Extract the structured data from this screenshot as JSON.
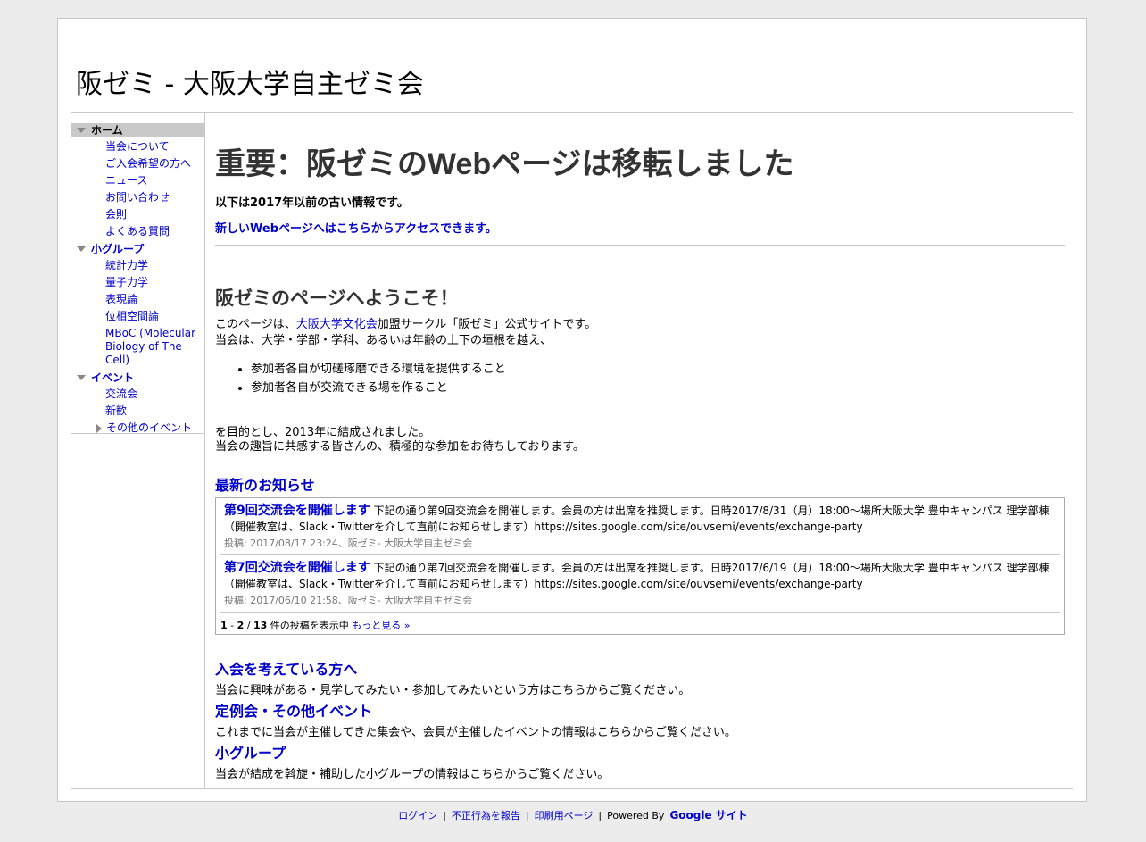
{
  "site": {
    "title": "阪ゼミ - 大阪大学自主ゼミ会"
  },
  "sidebar": {
    "groups": [
      {
        "label": "ホーム",
        "selected": true,
        "items": [
          "当会について",
          "ご入会希望の方へ",
          "ニュース",
          "お問い合わせ",
          "会則",
          "よくある質問"
        ]
      },
      {
        "label": "小グループ",
        "selected": false,
        "items": [
          "統計力学",
          "量子力学",
          "表現論",
          "位相空間論",
          "MBoC (Molecular Biology of The Cell)"
        ]
      },
      {
        "label": "イベント",
        "selected": false,
        "items": [
          "交流会",
          "新歓",
          "その他のイベント"
        ]
      }
    ]
  },
  "main": {
    "title": "重要：阪ゼミのWebページは移転しました",
    "notice_old": "以下は2017年以前の古い情報です。",
    "notice_link": "新しいWebページへはこちらからアクセスできます。",
    "welcome_title": "阪ゼミのページへようこそ！",
    "intro_prefix": "このページは、",
    "intro_link": "大阪大学文化会",
    "intro_suffix": "加盟サークル「阪ゼミ」公式サイトです。",
    "intro_line2": "当会は、大学・学部・学科、あるいは年齢の上下の垣根を越え、",
    "goals": [
      "参加者各自が切磋琢磨できる環境を提供すること",
      "参加者各自が交流できる場を作ること"
    ],
    "outro_line1": "を目的とし、2013年に結成されました。",
    "outro_line2": "当会の趣旨に共感する皆さんの、積極的な参加をお待ちしております。",
    "news": {
      "title": "最新のお知らせ",
      "entries": [
        {
          "headline": "第9回交流会を開催します",
          "body": " 下記の通り第9回交流会を開催します。会員の方は出席を推奨します。日時2017/8/31（月）18:00〜場所大阪大学 豊中キャンパス 理学部棟（開催教室は、Slack・Twitterを介して直前にお知らせします）https://sites.google.com/site/ouvsemi/events/exchange-party",
          "meta": "投稿: 2017/08/17 23:24、阪ゼミ- 大阪大学自主ゼミ会"
        },
        {
          "headline": "第7回交流会を開催します",
          "body": " 下記の通り第7回交流会を開催します。会員の方は出席を推奨します。日時2017/6/19（月）18:00〜場所大阪大学 豊中キャンパス 理学部棟（開催教室は、Slack・Twitterを介して直前にお知らせします）https://sites.google.com/site/ouvsemi/events/exchange-party",
          "meta": "投稿: 2017/06/10 21:58、阪ゼミ- 大阪大学自主ゼミ会"
        }
      ],
      "range_start": "1",
      "range_end": "2",
      "total": "13",
      "range_suffix": " 件の投稿を表示中 ",
      "more_label": "もっと見る »"
    },
    "sections": [
      {
        "title": "入会を考えている方へ",
        "text": "当会に興味がある・見学してみたい・参加してみたいという方はこちらからご覧ください。"
      },
      {
        "title": "定例会・その他イベント",
        "text": "これまでに当会が主催してきた集会や、会員が主催したイベントの情報はこちらからご覧ください。"
      },
      {
        "title": "小グループ",
        "text": "当会が結成を斡旋・補助した小グループの情報はこちらからご覧ください。"
      }
    ]
  },
  "footer": {
    "login": "ログイン",
    "report": "不正行為を報告",
    "print": "印刷用ページ",
    "powered_by": "Powered By",
    "google_sites": "Google サイト"
  }
}
